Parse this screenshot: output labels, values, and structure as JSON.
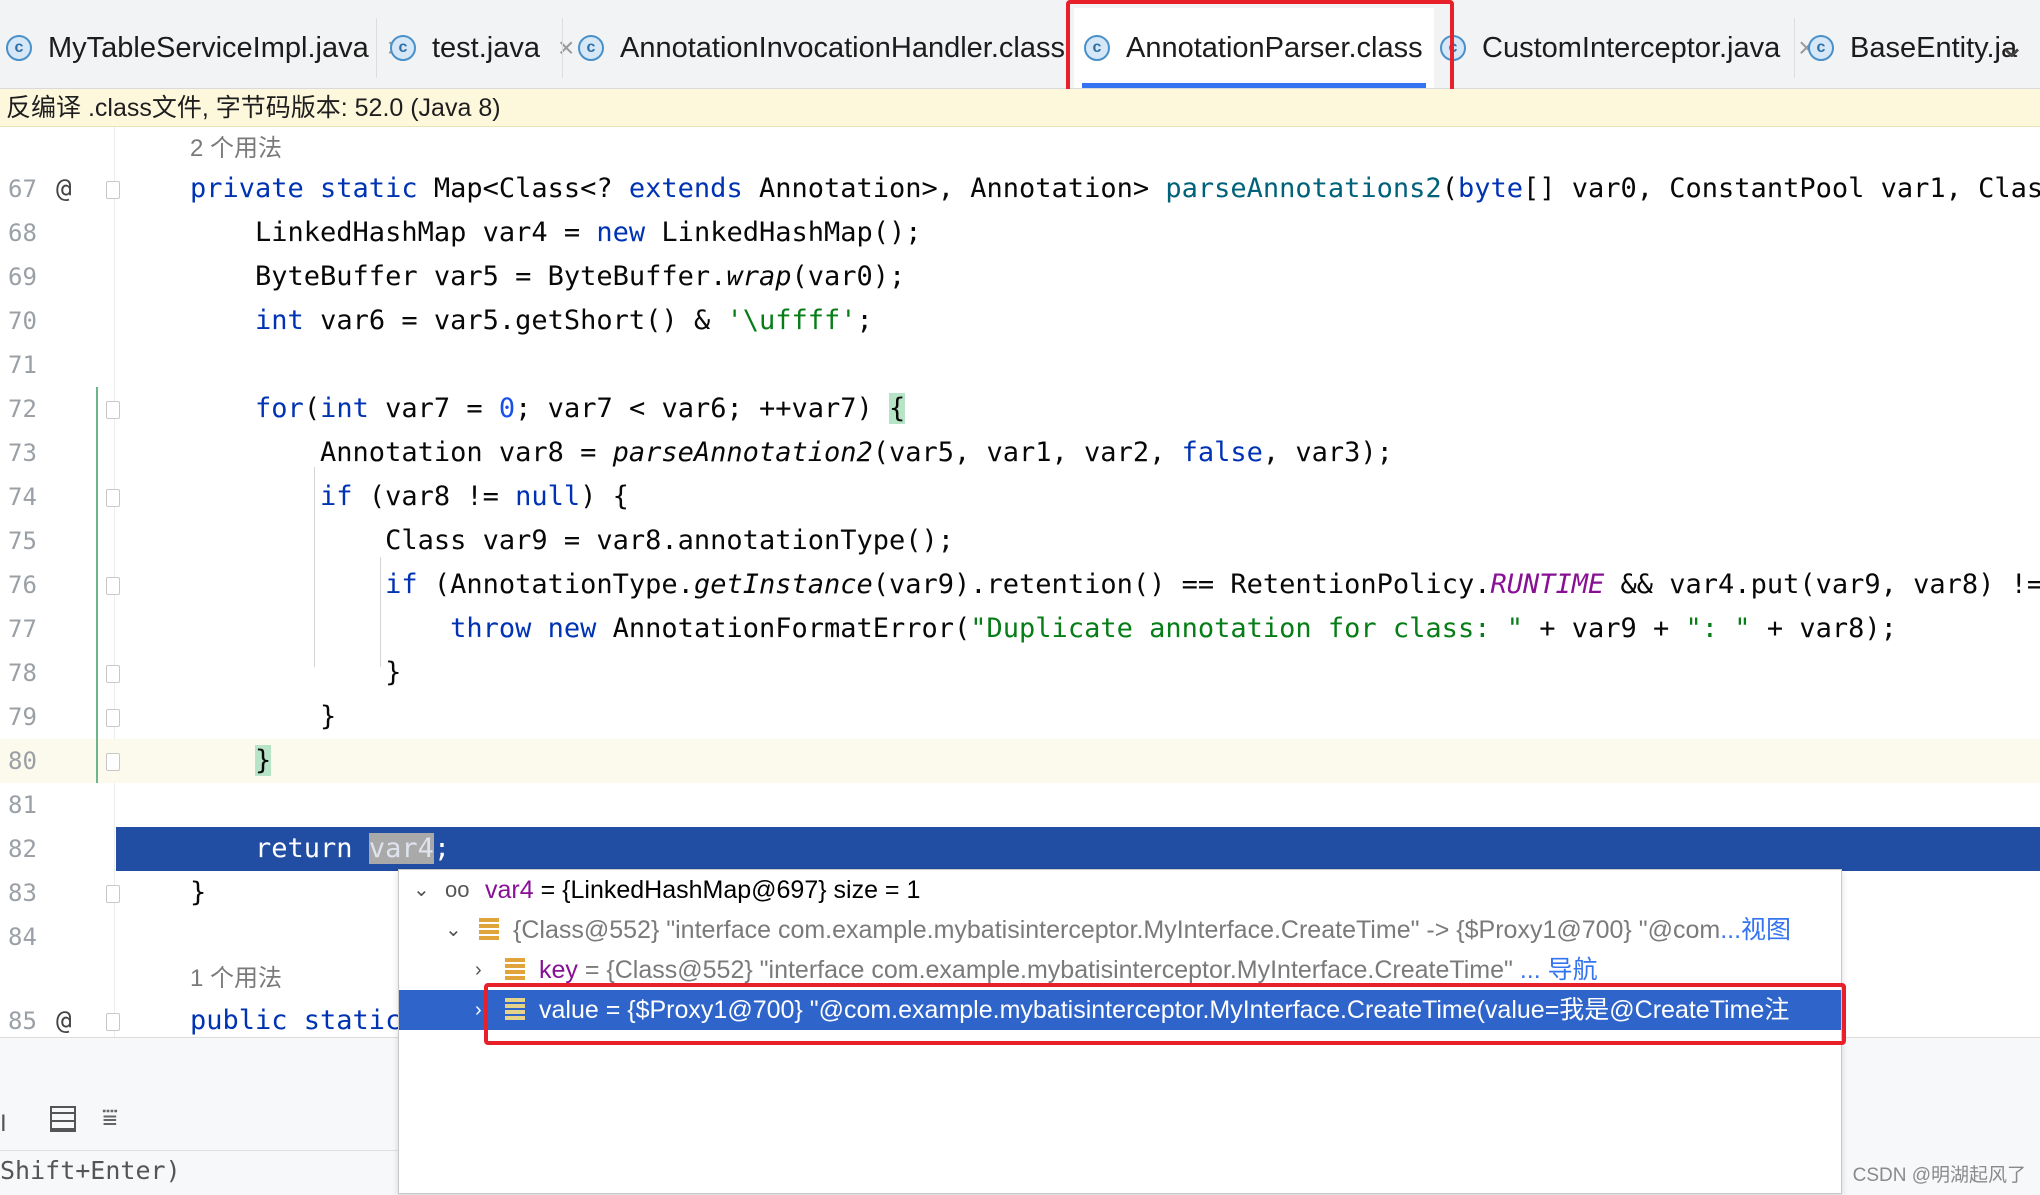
{
  "tabs": [
    {
      "label": "MyTableServiceImpl.java",
      "icon": "class-icon"
    },
    {
      "label": "test.java",
      "icon": "class-run-icon"
    },
    {
      "label": "AnnotationInvocationHandler.class",
      "icon": "class-icon"
    },
    {
      "label": "AnnotationParser.class",
      "icon": "class-icon",
      "active": true
    },
    {
      "label": "CustomInterceptor.java",
      "icon": "class-icon"
    },
    {
      "label": "BaseEntity.ja",
      "icon": "class-icon"
    }
  ],
  "infobar": {
    "text": "反编译 .class文件, 字节码版本: 52.0 (Java 8)"
  },
  "editor": {
    "usages_top": "2 个用法",
    "usages_bottom": "1 个用法",
    "line_numbers": [
      "67",
      "68",
      "69",
      "70",
      "71",
      "72",
      "73",
      "74",
      "75",
      "76",
      "77",
      "78",
      "79",
      "80",
      "81",
      "82",
      "83",
      "84",
      "85"
    ]
  },
  "debug_popup": {
    "root": {
      "name": "var4",
      "value": " = {LinkedHashMap@697}  size = 1"
    },
    "entry": {
      "text": "{Class@552} \"interface com.example.mybatisinterceptor.MyInterface.CreateTime\" -> {$Proxy1@700} \"@com",
      "link": "...视图"
    },
    "key": {
      "name": "key",
      "value": " = {Class@552} \"interface com.example.mybatisinterceptor.MyInterface.CreateTime\" ",
      "link": "... 导航"
    },
    "value": {
      "text": "value = {$Proxy1@700} \"@com.example.mybatisinterceptor.MyInterface.CreateTime(value=我是@CreateTime注"
    }
  },
  "bottom": {
    "eval_hint": "Shift+Enter)"
  },
  "watermark": "CSDN @明湖起风了",
  "colors": {
    "accent": "#3574f0",
    "highlight_box": "#e8202a",
    "selection": "#214da3"
  }
}
